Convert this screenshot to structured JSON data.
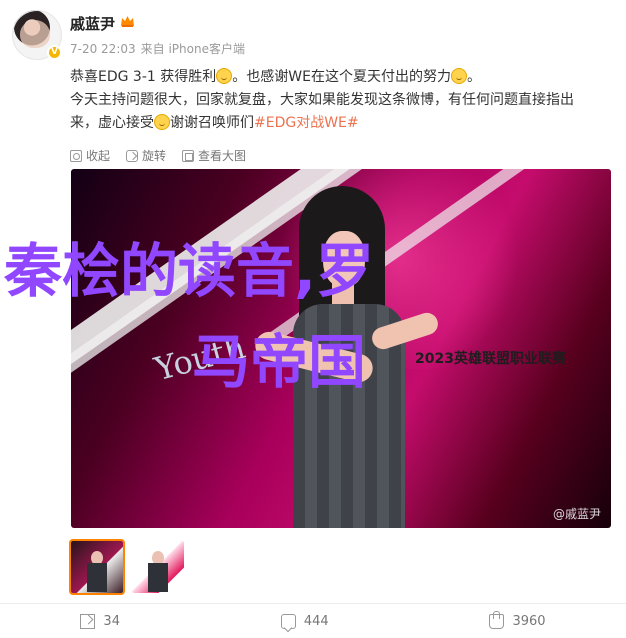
{
  "user": {
    "name": "戚蓝尹",
    "time": "7-20 22:03",
    "source": "来自 iPhone客户端"
  },
  "post": {
    "line1": "恭喜EDG 3-1 获得胜利",
    "line1b": "。也感谢WE在这个夏天付出的努力",
    "line1c": "。",
    "line2": "今天主持问题很大，回家就复盘，大家如果能发现这条微博，有任何问题直接指出",
    "line3a": "来，虚心接受",
    "line3b": "谢谢召唤师们",
    "tag": "#EDG对战WE#"
  },
  "actions": {
    "collect": "收起",
    "rotate": "旋转",
    "view_large": "查看大图"
  },
  "image": {
    "watermark": "@戚蓝尹",
    "banner": "2023英雄联盟职业联赛",
    "youth": "Youth",
    "overlay_line1": "秦桧的读音,罗",
    "overlay_line2": "马帝国"
  },
  "footer": {
    "repost": "34",
    "comment": "444",
    "like": "3960"
  },
  "colors": {
    "accent": "#eb7350",
    "overlay": "#9147ff"
  },
  "icons": [
    "crown-icon",
    "verified-icon",
    "collect-icon",
    "rotate-icon",
    "view-icon",
    "repost-icon",
    "comment-icon",
    "like-icon"
  ]
}
